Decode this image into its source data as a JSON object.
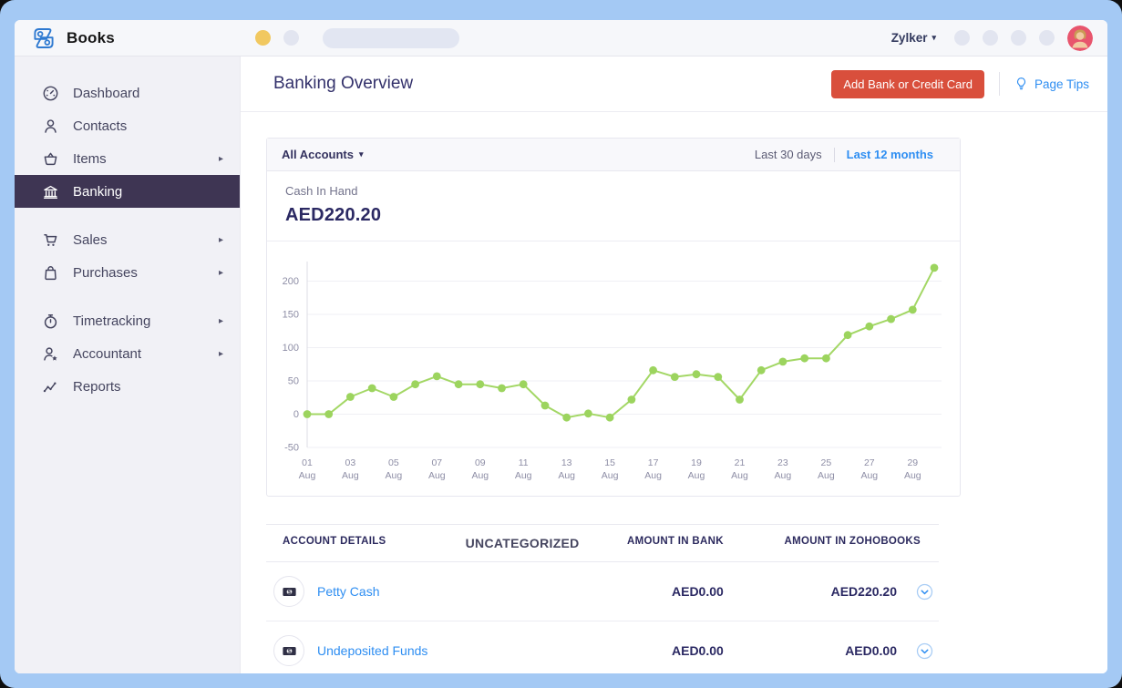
{
  "topbar": {
    "brand": "Books",
    "org_name": "Zylker"
  },
  "sidebar": {
    "items": [
      {
        "label": "Dashboard",
        "icon": "gauge-icon",
        "arrow": false,
        "selected": false,
        "group_break": false
      },
      {
        "label": "Contacts",
        "icon": "person-icon",
        "arrow": false,
        "selected": false,
        "group_break": false
      },
      {
        "label": "Items",
        "icon": "basket-icon",
        "arrow": true,
        "selected": false,
        "group_break": false
      },
      {
        "label": "Banking",
        "icon": "bank-icon",
        "arrow": false,
        "selected": true,
        "group_break": false
      },
      {
        "label": "Sales",
        "icon": "cart-icon",
        "arrow": true,
        "selected": false,
        "group_break": true
      },
      {
        "label": "Purchases",
        "icon": "bag-icon",
        "arrow": true,
        "selected": false,
        "group_break": false
      },
      {
        "label": "Timetracking",
        "icon": "stopwatch-icon",
        "arrow": true,
        "selected": false,
        "group_break": true
      },
      {
        "label": "Accountant",
        "icon": "person-star-icon",
        "arrow": true,
        "selected": false,
        "group_break": false
      },
      {
        "label": "Reports",
        "icon": "line-chart-icon",
        "arrow": false,
        "selected": false,
        "group_break": false
      }
    ]
  },
  "page": {
    "title": "Banking Overview",
    "add_button_label": "Add Bank or Credit Card",
    "page_tips_label": "Page Tips"
  },
  "overview_card": {
    "account_filter_label": "All Accounts",
    "ranges": [
      {
        "label": "Last 30 days",
        "active": false
      },
      {
        "label": "Last 12 months",
        "active": true
      }
    ],
    "summary_label": "Cash In Hand",
    "summary_value": "AED220.20"
  },
  "chart_data": {
    "type": "line",
    "title": "",
    "xlabel": "",
    "ylabel": "",
    "x": [
      "01",
      "02",
      "03",
      "04",
      "05",
      "06",
      "07",
      "08",
      "09",
      "10",
      "11",
      "12",
      "13",
      "14",
      "15",
      "16",
      "17",
      "18",
      "19",
      "20",
      "21",
      "22",
      "23",
      "24",
      "25",
      "26",
      "27",
      "28",
      "29",
      "30"
    ],
    "month": "Aug",
    "x_label_step": 2,
    "series": [
      {
        "name": "Cash In Hand",
        "values": [
          0,
          0,
          26,
          39,
          26,
          45,
          57,
          45,
          45,
          39,
          45,
          13,
          -5,
          1,
          -5,
          22,
          66,
          56,
          60,
          56,
          22,
          66,
          79,
          84,
          84,
          119,
          132,
          143,
          157,
          220
        ]
      }
    ],
    "ylim": [
      -50,
      235
    ],
    "yticks": [
      200,
      150,
      100,
      50,
      0,
      -50
    ],
    "grid": true,
    "legend": false,
    "line_color": "#a3d765",
    "marker_color": "#9cd45e"
  },
  "accounts_table": {
    "columns": [
      "ACCOUNT DETAILS",
      "UNCATEGORIZED",
      "AMOUNT IN BANK",
      "AMOUNT IN ZOHOBOOKS"
    ],
    "rows": [
      {
        "name": "Petty Cash",
        "icon": "cash-icon",
        "uncategorized": "",
        "amount_in_bank": "AED0.00",
        "amount_in_zohobooks": "AED220.20"
      },
      {
        "name": "Undeposited Funds",
        "icon": "cash-icon",
        "uncategorized": "",
        "amount_in_bank": "AED0.00",
        "amount_in_zohobooks": "AED0.00"
      }
    ]
  },
  "colors": {
    "frame_blue": "#a4c9f4",
    "nav_selected_bg": "#3e3553",
    "accent_red": "#d94f3c",
    "accent_blue": "#2e8ef2",
    "chart_line": "#a3d765",
    "chart_marker": "#9cd45e",
    "amount_text": "#2b2963"
  }
}
